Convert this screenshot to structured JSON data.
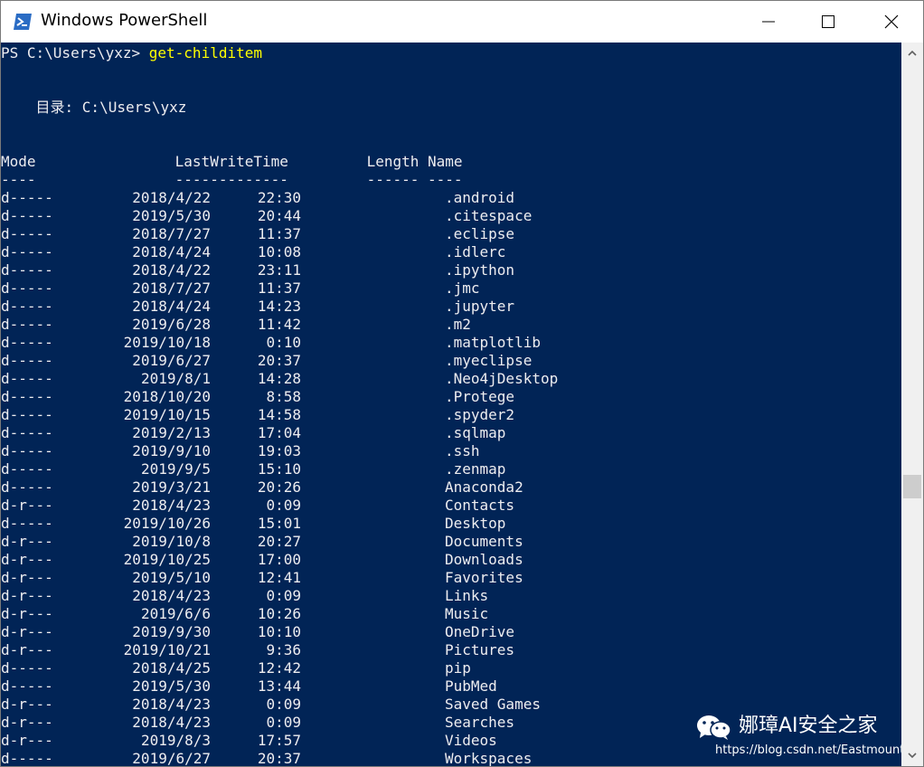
{
  "window": {
    "title": "Windows PowerShell",
    "controls": [
      "minimize-icon",
      "maximize-icon",
      "close-icon"
    ]
  },
  "console": {
    "prompt": "PS C:\\Users\\yxz> ",
    "command": "get-childitem",
    "directory_line": "    目录: C:\\Users\\yxz",
    "header_line": "Mode                LastWriteTime         Length Name",
    "separator_line": "----                -------------         ------ ----",
    "colors": {
      "background": "#012456",
      "text": "#eeedf0",
      "command": "#ffff00"
    },
    "entries": [
      {
        "mode": "d-----",
        "date": "2018/4/22",
        "time": "22:30",
        "name": ".android"
      },
      {
        "mode": "d-----",
        "date": "2019/5/30",
        "time": "20:44",
        "name": ".citespace"
      },
      {
        "mode": "d-----",
        "date": "2018/7/27",
        "time": "11:37",
        "name": ".eclipse"
      },
      {
        "mode": "d-----",
        "date": "2018/4/24",
        "time": "10:08",
        "name": ".idlerc"
      },
      {
        "mode": "d-----",
        "date": "2018/4/22",
        "time": "23:11",
        "name": ".ipython"
      },
      {
        "mode": "d-----",
        "date": "2018/7/27",
        "time": "11:37",
        "name": ".jmc"
      },
      {
        "mode": "d-----",
        "date": "2018/4/24",
        "time": "14:23",
        "name": ".jupyter"
      },
      {
        "mode": "d-----",
        "date": "2019/6/28",
        "time": "11:42",
        "name": ".m2"
      },
      {
        "mode": "d-----",
        "date": "2019/10/18",
        "time": "0:10",
        "name": ".matplotlib"
      },
      {
        "mode": "d-----",
        "date": "2019/6/27",
        "time": "20:37",
        "name": ".myeclipse"
      },
      {
        "mode": "d-----",
        "date": "2019/8/1",
        "time": "14:28",
        "name": ".Neo4jDesktop"
      },
      {
        "mode": "d-----",
        "date": "2018/10/20",
        "time": "8:58",
        "name": ".Protege"
      },
      {
        "mode": "d-----",
        "date": "2019/10/15",
        "time": "14:58",
        "name": ".spyder2"
      },
      {
        "mode": "d-----",
        "date": "2019/2/13",
        "time": "17:04",
        "name": ".sqlmap"
      },
      {
        "mode": "d-----",
        "date": "2019/9/10",
        "time": "19:03",
        "name": ".ssh"
      },
      {
        "mode": "d-----",
        "date": "2019/9/5",
        "time": "15:10",
        "name": ".zenmap"
      },
      {
        "mode": "d-----",
        "date": "2019/3/21",
        "time": "20:26",
        "name": "Anaconda2"
      },
      {
        "mode": "d-r---",
        "date": "2018/4/23",
        "time": "0:09",
        "name": "Contacts"
      },
      {
        "mode": "d-----",
        "date": "2019/10/26",
        "time": "15:01",
        "name": "Desktop"
      },
      {
        "mode": "d-r---",
        "date": "2019/10/8",
        "time": "20:27",
        "name": "Documents"
      },
      {
        "mode": "d-r---",
        "date": "2019/10/25",
        "time": "17:00",
        "name": "Downloads"
      },
      {
        "mode": "d-r---",
        "date": "2019/5/10",
        "time": "12:41",
        "name": "Favorites"
      },
      {
        "mode": "d-r---",
        "date": "2018/4/23",
        "time": "0:09",
        "name": "Links"
      },
      {
        "mode": "d-r---",
        "date": "2019/6/6",
        "time": "10:26",
        "name": "Music"
      },
      {
        "mode": "d-r---",
        "date": "2019/9/30",
        "time": "10:10",
        "name": "OneDrive"
      },
      {
        "mode": "d-r---",
        "date": "2019/10/21",
        "time": "9:36",
        "name": "Pictures"
      },
      {
        "mode": "d-----",
        "date": "2018/4/25",
        "time": "12:42",
        "name": "pip"
      },
      {
        "mode": "d-----",
        "date": "2019/5/30",
        "time": "13:44",
        "name": "PubMed"
      },
      {
        "mode": "d-r---",
        "date": "2018/4/23",
        "time": "0:09",
        "name": "Saved Games"
      },
      {
        "mode": "d-r---",
        "date": "2018/4/23",
        "time": "0:09",
        "name": "Searches"
      },
      {
        "mode": "d-r---",
        "date": "2019/8/3",
        "time": "17:57",
        "name": "Videos"
      },
      {
        "mode": "d-----",
        "date": "2019/6/27",
        "time": "20:37",
        "name": "Workspaces"
      }
    ]
  },
  "watermark": {
    "text": "娜璋AI安全之家",
    "url": "https://blog.csdn.net/Eastmount"
  }
}
